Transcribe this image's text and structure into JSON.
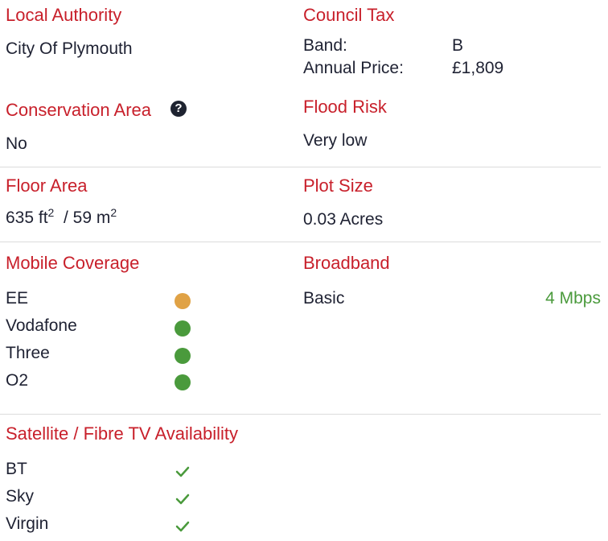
{
  "local_authority": {
    "heading": "Local Authority",
    "value": "City Of Plymouth"
  },
  "council_tax": {
    "heading": "Council Tax",
    "band_label": "Band:",
    "band_value": "B",
    "price_label": "Annual Price:",
    "price_value": "£1,809"
  },
  "conservation_area": {
    "heading": "Conservation Area",
    "help_glyph": "?",
    "value": "No"
  },
  "flood_risk": {
    "heading": "Flood Risk",
    "value": "Very low"
  },
  "floor_area": {
    "heading": "Floor Area",
    "ft_value": "635 ft",
    "ft_exp": "2",
    "sep": "/ 59 m",
    "m_exp": "2"
  },
  "plot_size": {
    "heading": "Plot Size",
    "value": "0.03 Acres"
  },
  "mobile_coverage": {
    "heading": "Mobile Coverage",
    "carriers": [
      {
        "name": "EE",
        "status_color": "#e0a245"
      },
      {
        "name": "Vodafone",
        "status_color": "#4a9a3c"
      },
      {
        "name": "Three",
        "status_color": "#4a9a3c"
      },
      {
        "name": "O2",
        "status_color": "#4a9a3c"
      }
    ]
  },
  "broadband": {
    "heading": "Broadband",
    "type": "Basic",
    "speed": "4 Mbps",
    "speed_color": "#4a9a3c"
  },
  "tv": {
    "heading": "Satellite / Fibre TV Availability",
    "providers": [
      {
        "name": "BT",
        "icon": "check-icon"
      },
      {
        "name": "Sky",
        "icon": "check-icon"
      },
      {
        "name": "Virgin",
        "icon": "check-icon"
      }
    ]
  },
  "colors": {
    "accent": "#c8202b",
    "text": "#1f2233",
    "good": "#4a9a3c",
    "medium": "#e0a245",
    "divider": "#dcdcdc"
  }
}
